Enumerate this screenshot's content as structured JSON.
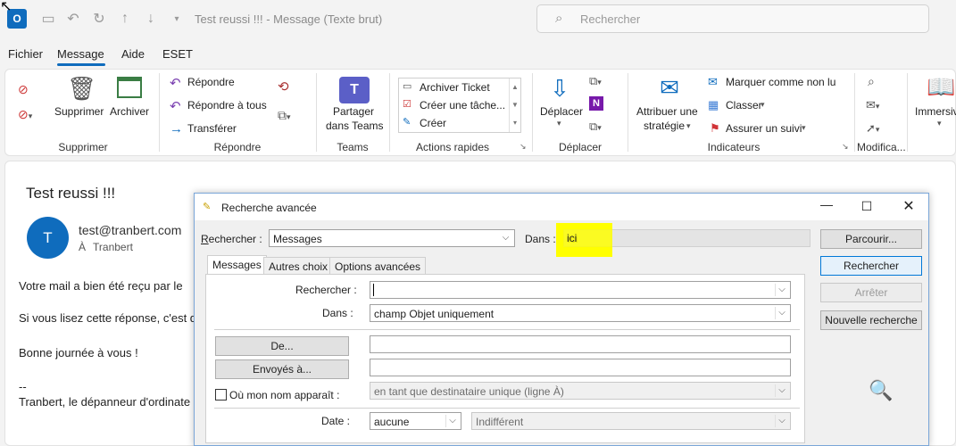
{
  "window": {
    "title": "Test reussi !!!  -  Message (Texte brut)",
    "search_placeholder": "Rechercher"
  },
  "menu": [
    "Fichier",
    "Message",
    "Aide",
    "ESET"
  ],
  "ribbon": {
    "groups": {
      "supprimer": {
        "label": "Supprimer",
        "delete": "Supprimer",
        "archive": "Archiver"
      },
      "repondre": {
        "label": "Répondre",
        "reply": "Répondre",
        "reply_all": "Répondre à tous",
        "forward": "Transférer"
      },
      "teams": {
        "label": "Teams",
        "share_line1": "Partager",
        "share_line2": "dans Teams"
      },
      "actions_rapides": {
        "label": "Actions rapides",
        "items": [
          "Archiver Ticket",
          "Créer une tâche...",
          "Créer"
        ]
      },
      "deplacer": {
        "label": "Déplacer",
        "move": "Déplacer"
      },
      "indicateurs": {
        "label": "Indicateurs",
        "assign_line1": "Attribuer une",
        "assign_line2": "stratégie",
        "mark_unread": "Marquer comme non lu",
        "categorize": "Classer",
        "follow_up": "Assurer un suivi"
      },
      "modification": {
        "label": "Modifica..."
      },
      "immersive": {
        "label": "Immersiv"
      }
    }
  },
  "mail": {
    "subject": "Test reussi !!!",
    "avatar_letter": "T",
    "sender": "test@tranbert.com",
    "to_prefix": "À",
    "to": "Tranbert",
    "body": [
      "Votre mail  a bien été reçu par le",
      "Si vous lisez cette réponse, c'est d",
      "Bonne journée à vous !",
      "--",
      "Tranbert, le dépanneur d'ordinate"
    ]
  },
  "dialog": {
    "title": "Recherche avancée",
    "look_for_label": "Rechercher :",
    "look_for_value": "Messages",
    "in_label": "Dans :",
    "in_value": "ici",
    "buttons": {
      "browse": "Parcourir...",
      "find": "Rechercher",
      "stop": "Arrêter",
      "new_search": "Nouvelle recherche"
    },
    "tabs": [
      "Messages",
      "Autres choix",
      "Options avancées"
    ],
    "search_label": "Rechercher :",
    "search_value": "",
    "in_field_label": "Dans :",
    "in_field_value": "champ Objet uniquement",
    "from_button": "De...",
    "sent_to_button": "Envoyés à...",
    "where_label": "Où mon nom apparaît :",
    "where_value": "en tant que destinataire unique (ligne À)",
    "date_label": "Date :",
    "date_value": "aucune",
    "date_range_value": "Indifférent"
  },
  "colors": {
    "accent": "#0f6cbd",
    "highlight": "#ffff00"
  }
}
